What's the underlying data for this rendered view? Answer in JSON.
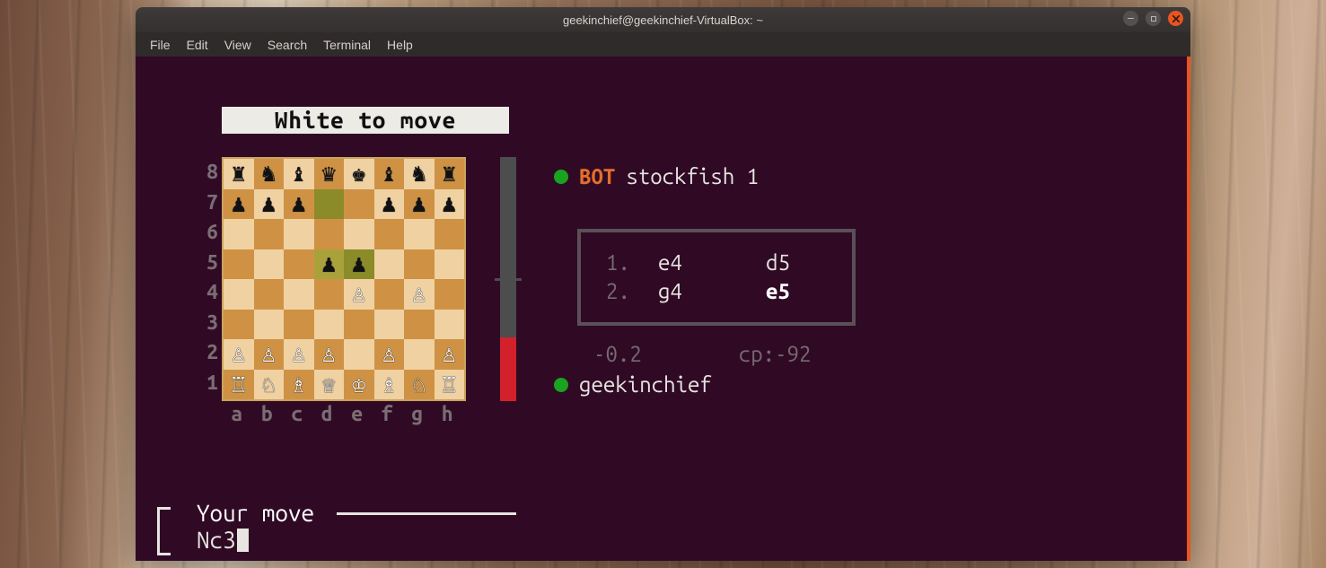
{
  "window": {
    "title": "geekinchief@geekinchief-VirtualBox: ~"
  },
  "menu": {
    "file": "File",
    "edit": "Edit",
    "view": "View",
    "search": "Search",
    "terminal": "Terminal",
    "help": "Help"
  },
  "game": {
    "turn_label": "White to move",
    "ranks": [
      "8",
      "7",
      "6",
      "5",
      "4",
      "3",
      "2",
      "1"
    ],
    "files": [
      "a",
      "b",
      "c",
      "d",
      "e",
      "f",
      "g",
      "h"
    ],
    "board": [
      [
        {
          "p": "♜",
          "c": "b"
        },
        {
          "p": "♞",
          "c": "b"
        },
        {
          "p": "♝",
          "c": "b"
        },
        {
          "p": "♛",
          "c": "b"
        },
        {
          "p": "♚",
          "c": "b"
        },
        {
          "p": "♝",
          "c": "b"
        },
        {
          "p": "♞",
          "c": "b"
        },
        {
          "p": "♜",
          "c": "b"
        }
      ],
      [
        {
          "p": "♟",
          "c": "b"
        },
        {
          "p": "♟",
          "c": "b"
        },
        {
          "p": "♟",
          "c": "b"
        },
        {
          "p": "",
          "c": "",
          "hl": "hd"
        },
        {
          "p": "",
          "c": ""
        },
        {
          "p": "♟",
          "c": "b"
        },
        {
          "p": "♟",
          "c": "b"
        },
        {
          "p": "♟",
          "c": "b"
        }
      ],
      [
        {
          "p": "",
          "c": ""
        },
        {
          "p": "",
          "c": ""
        },
        {
          "p": "",
          "c": ""
        },
        {
          "p": "",
          "c": ""
        },
        {
          "p": "",
          "c": ""
        },
        {
          "p": "",
          "c": ""
        },
        {
          "p": "",
          "c": ""
        },
        {
          "p": "",
          "c": ""
        }
      ],
      [
        {
          "p": "",
          "c": ""
        },
        {
          "p": "",
          "c": ""
        },
        {
          "p": "",
          "c": ""
        },
        {
          "p": "♟",
          "c": "b",
          "hl": "hl"
        },
        {
          "p": "♟",
          "c": "b",
          "hl": "hd"
        },
        {
          "p": "",
          "c": ""
        },
        {
          "p": "",
          "c": ""
        },
        {
          "p": "",
          "c": ""
        }
      ],
      [
        {
          "p": "",
          "c": ""
        },
        {
          "p": "",
          "c": ""
        },
        {
          "p": "",
          "c": ""
        },
        {
          "p": "",
          "c": ""
        },
        {
          "p": "♙",
          "c": "w"
        },
        {
          "p": "",
          "c": ""
        },
        {
          "p": "♙",
          "c": "w"
        },
        {
          "p": "",
          "c": ""
        }
      ],
      [
        {
          "p": "",
          "c": ""
        },
        {
          "p": "",
          "c": ""
        },
        {
          "p": "",
          "c": ""
        },
        {
          "p": "",
          "c": ""
        },
        {
          "p": "",
          "c": ""
        },
        {
          "p": "",
          "c": ""
        },
        {
          "p": "",
          "c": ""
        },
        {
          "p": "",
          "c": ""
        }
      ],
      [
        {
          "p": "♙",
          "c": "w"
        },
        {
          "p": "♙",
          "c": "w"
        },
        {
          "p": "♙",
          "c": "w"
        },
        {
          "p": "♙",
          "c": "w"
        },
        {
          "p": "",
          "c": ""
        },
        {
          "p": "♙",
          "c": "w"
        },
        {
          "p": "",
          "c": ""
        },
        {
          "p": "♙",
          "c": "w"
        }
      ],
      [
        {
          "p": "♖",
          "c": "w"
        },
        {
          "p": "♘",
          "c": "w"
        },
        {
          "p": "♗",
          "c": "w"
        },
        {
          "p": "♕",
          "c": "w"
        },
        {
          "p": "♔",
          "c": "w"
        },
        {
          "p": "♗",
          "c": "w"
        },
        {
          "p": "♘",
          "c": "w"
        },
        {
          "p": "♖",
          "c": "w"
        }
      ]
    ],
    "eval_bar": {
      "red_pct": 26,
      "tick_pct": 50
    },
    "opponent": {
      "tag": "BOT",
      "name": "stockfish 1"
    },
    "moves": [
      {
        "n": "1.",
        "w": "e4",
        "b": "d5"
      },
      {
        "n": "2.",
        "w": "g4",
        "b": "e5"
      }
    ],
    "eval_text_left": "-0.2",
    "eval_text_right": "cp:-92",
    "player": {
      "name": "geekinchief"
    },
    "prompt": {
      "label": "Your move",
      "input": "Nc3"
    }
  }
}
